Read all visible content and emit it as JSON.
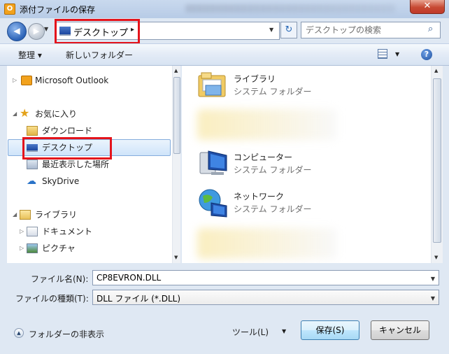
{
  "window": {
    "title": "添付ファイルの保存",
    "app_icon": "outlook-icon",
    "close_glyph": "✕"
  },
  "address_bar": {
    "location": "デスクトップ",
    "search_placeholder": "デスクトップの検索"
  },
  "toolbar": {
    "organize_label": "整理 ▾",
    "new_folder_label": "新しいフォルダー",
    "help_glyph": "?"
  },
  "nav_pane": {
    "items": [
      {
        "label": "Microsoft Outlook",
        "icon": "outlook-icon"
      },
      {
        "label": "お気に入り",
        "icon": "star-icon"
      },
      {
        "label": "ダウンロード",
        "icon": "downloads-folder-icon"
      },
      {
        "label": "デスクトップ",
        "icon": "desktop-icon",
        "selected": true
      },
      {
        "label": "最近表示した場所",
        "icon": "recent-places-icon"
      },
      {
        "label": "SkyDrive",
        "icon": "skydrive-cloud-icon"
      },
      {
        "label": "ライブラリ",
        "icon": "libraries-icon"
      },
      {
        "label": "ドキュメント",
        "icon": "documents-icon"
      },
      {
        "label": "ピクチャ",
        "icon": "pictures-icon"
      }
    ]
  },
  "content_items": [
    {
      "name": "ライブラリ",
      "type": "システム フォルダー",
      "icon": "libraries-icon"
    },
    {
      "name": "コンピューター",
      "type": "システム フォルダー",
      "icon": "computer-icon"
    },
    {
      "name": "ネットワーク",
      "type": "システム フォルダー",
      "icon": "network-globe-icon"
    }
  ],
  "form": {
    "file_name_label": "ファイル名(N):",
    "file_name_value": "CP8EVRON.DLL",
    "file_type_label": "ファイルの種類(T):",
    "file_type_value": "DLL ファイル (*.DLL)",
    "hide_folders_label": "フォルダーの非表示",
    "tools_label": "ツール(L)",
    "save_label": "保存(S)",
    "cancel_label": "キャンセル"
  },
  "colors": {
    "highlight_box": "#e4141c",
    "selection_border": "#84acdd",
    "window_frame": "#dfe8f3"
  }
}
